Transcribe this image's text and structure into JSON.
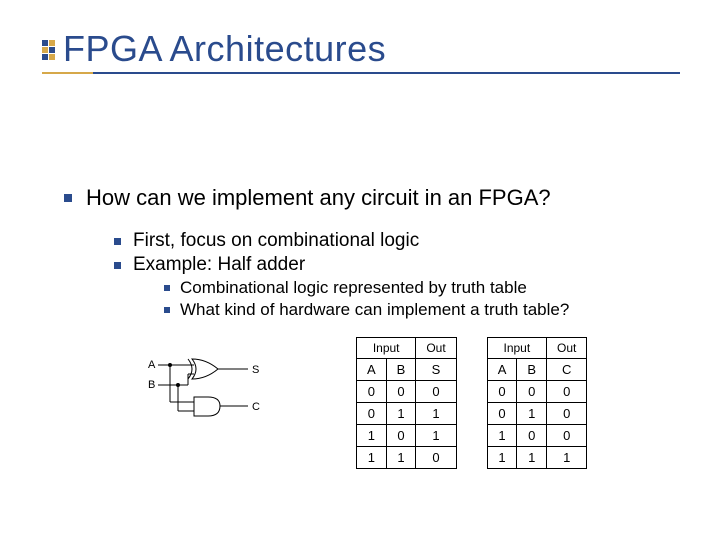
{
  "title": "FPGA Architectures",
  "l1": "How can we implement any circuit in an FPGA?",
  "l2a": "First, focus on combinational logic",
  "l2b": "Example: Half adder",
  "l3a": "Combinational logic represented by truth table",
  "l3b": "What kind of hardware can implement a truth table?",
  "circuit": {
    "A": "A",
    "B": "B",
    "S": "S",
    "C": "C"
  },
  "table_s": {
    "input_label": "Input",
    "out_label": "Out",
    "h1": "A",
    "h2": "B",
    "h3": "S",
    "rows": [
      [
        "0",
        "0",
        "0"
      ],
      [
        "0",
        "1",
        "1"
      ],
      [
        "1",
        "0",
        "1"
      ],
      [
        "1",
        "1",
        "0"
      ]
    ]
  },
  "table_c": {
    "input_label": "Input",
    "out_label": "Out",
    "h1": "A",
    "h2": "B",
    "h3": "C",
    "rows": [
      [
        "0",
        "0",
        "0"
      ],
      [
        "0",
        "1",
        "0"
      ],
      [
        "1",
        "0",
        "0"
      ],
      [
        "1",
        "1",
        "1"
      ]
    ]
  }
}
